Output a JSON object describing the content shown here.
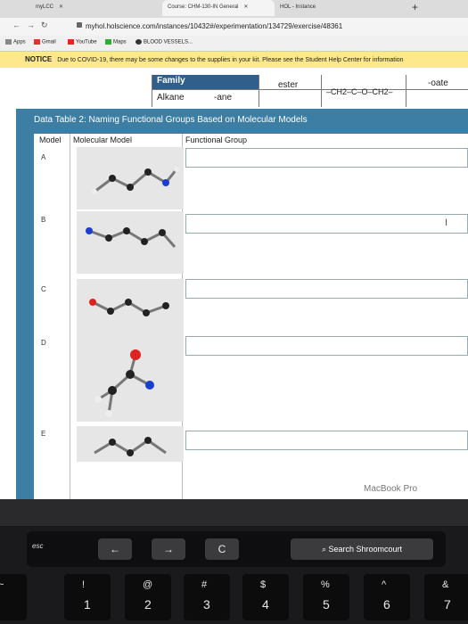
{
  "browser": {
    "tabs": [
      {
        "label": "myLCC"
      },
      {
        "label": "Course: CHM-130-IN General"
      },
      {
        "label": "HOL - Instance"
      }
    ],
    "url": "myhol.holscience.com/instances/10432#/experimentation/134729/exercise/48361",
    "bookmarks": [
      "Apps",
      "Gmail",
      "YouTube",
      "Maps",
      "BLOOD VESSELS..."
    ]
  },
  "notice": {
    "label": "NOTICE",
    "text": "Due to COVID-19, there may be some changes to the supplies in your kit. Please see the Student Help Center for information"
  },
  "family_table": {
    "header": "Family",
    "row1": [
      "ester",
      "-oate"
    ],
    "row2": [
      "Alkane",
      "-ane"
    ],
    "structure": "–CH2–C–O–CH2–"
  },
  "data_table": {
    "title": "Data Table 2: Naming Functional Groups Based on Molecular Models",
    "columns": [
      "Model",
      "Molecular Model",
      "Functional Group"
    ],
    "rows": [
      {
        "model": "A",
        "functional_group": ""
      },
      {
        "model": "B",
        "functional_group": ""
      },
      {
        "model": "C",
        "functional_group": ""
      },
      {
        "model": "D",
        "functional_group": ""
      },
      {
        "model": "E",
        "functional_group": ""
      }
    ]
  },
  "laptop": {
    "brand_label": "MacBook Pro",
    "touchbar": {
      "esc": "esc",
      "back": "←",
      "forward": "→",
      "reload": "C",
      "search": "Search Shroomcourt"
    },
    "keys": [
      {
        "top": "~",
        "bottom": ""
      },
      {
        "top": "!",
        "bottom": "1"
      },
      {
        "top": "@",
        "bottom": "2"
      },
      {
        "top": "#",
        "bottom": "3"
      },
      {
        "top": "$",
        "bottom": "4"
      },
      {
        "top": "%",
        "bottom": "5"
      },
      {
        "top": "^",
        "bottom": "6"
      },
      {
        "top": "&",
        "bottom": "7"
      }
    ]
  }
}
